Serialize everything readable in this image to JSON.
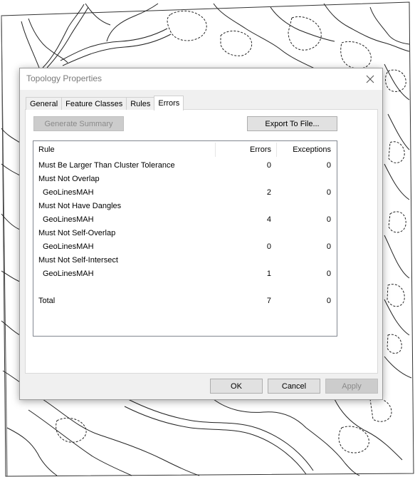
{
  "dialog": {
    "title": "Topology Properties",
    "tabs": [
      {
        "label": "General",
        "active": false
      },
      {
        "label": "Feature Classes",
        "active": false
      },
      {
        "label": "Rules",
        "active": false
      },
      {
        "label": "Errors",
        "active": true
      }
    ],
    "generate_summary_label": "Generate Summary",
    "export_label": "Export To File...",
    "table": {
      "columns": [
        "Rule",
        "Errors",
        "Exceptions"
      ],
      "rows": [
        {
          "rule": "Must Be Larger Than Cluster Tolerance",
          "errors": "0",
          "exceptions": "0",
          "indent": false
        },
        {
          "rule": "Must Not Overlap",
          "errors": "",
          "exceptions": "",
          "indent": false
        },
        {
          "rule": "GeoLinesMAH",
          "errors": "2",
          "exceptions": "0",
          "indent": true
        },
        {
          "rule": "Must Not Have Dangles",
          "errors": "",
          "exceptions": "",
          "indent": false
        },
        {
          "rule": "GeoLinesMAH",
          "errors": "4",
          "exceptions": "0",
          "indent": true
        },
        {
          "rule": "Must Not Self-Overlap",
          "errors": "",
          "exceptions": "",
          "indent": false
        },
        {
          "rule": "GeoLinesMAH",
          "errors": "0",
          "exceptions": "0",
          "indent": true
        },
        {
          "rule": "Must Not Self-Intersect",
          "errors": "",
          "exceptions": "",
          "indent": false
        },
        {
          "rule": "GeoLinesMAH",
          "errors": "1",
          "exceptions": "0",
          "indent": true
        },
        {
          "rule": "",
          "errors": "",
          "exceptions": "",
          "indent": false
        },
        {
          "rule": "Total",
          "errors": "7",
          "exceptions": "0",
          "indent": false
        }
      ]
    },
    "buttons": {
      "ok": "OK",
      "cancel": "Cancel",
      "apply": "Apply"
    }
  },
  "icons": {
    "close": "close-icon"
  },
  "colors": {
    "map_line": "#222222",
    "dialog_bg": "#f0f0f0",
    "disabled_text": "#8a8a8a"
  }
}
